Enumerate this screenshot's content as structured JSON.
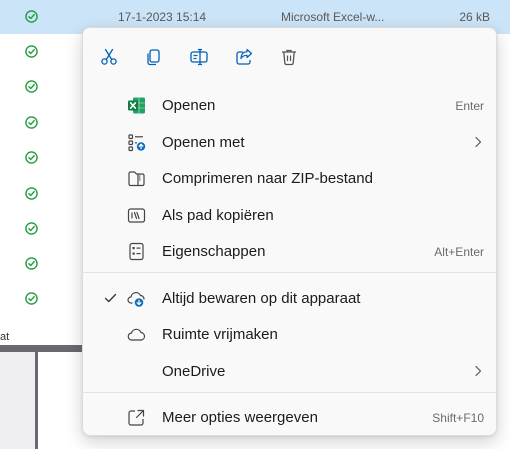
{
  "file_row": {
    "date": "17-1-2023 15:14",
    "type": "Microsoft Excel-w...",
    "size": "26 kB",
    "status_icon": "sync-ok-check-icon"
  },
  "background_status_icons": [
    "sync-ok-check-icon",
    "sync-ok-check-icon",
    "sync-ok-check-icon",
    "sync-ok-check-icon",
    "sync-ok-check-icon",
    "sync-ok-check-icon",
    "sync-ok-check-icon",
    "sync-ok-check-icon"
  ],
  "background_stub_text": "at",
  "context_menu": {
    "toolbar": [
      {
        "icon": "cut-icon"
      },
      {
        "icon": "copy-icon"
      },
      {
        "icon": "rename-icon"
      },
      {
        "icon": "share-icon"
      },
      {
        "icon": "delete-icon"
      }
    ],
    "items": [
      {
        "label": "Openen",
        "shortcut": "Enter",
        "icon": "excel-icon"
      },
      {
        "label": "Openen met",
        "icon": "open-with-icon",
        "submenu": true
      },
      {
        "label": "Comprimeren naar ZIP-bestand",
        "icon": "zip-folder-icon"
      },
      {
        "label": "Als pad kopiëren",
        "icon": "copy-path-icon"
      },
      {
        "label": "Eigenschappen",
        "shortcut": "Alt+Enter",
        "icon": "properties-icon"
      },
      {
        "label": "Altijd bewaren op dit apparaat",
        "icon": "onedrive-keep-icon",
        "checked": true
      },
      {
        "label": "Ruimte vrijmaken",
        "icon": "cloud-icon"
      },
      {
        "label": "OneDrive",
        "submenu": true
      },
      {
        "label": "Meer opties weergeven",
        "shortcut": "Shift+F10",
        "icon": "more-options-icon"
      }
    ]
  },
  "colors": {
    "selection": "#cce4f7",
    "accent": "#005fb8",
    "status_green": "#1f9d3c",
    "excel_green": "#107c41"
  }
}
